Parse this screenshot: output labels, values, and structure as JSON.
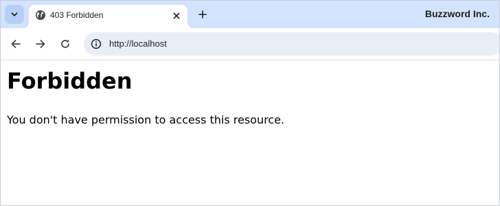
{
  "browser": {
    "tab_search_icon": "chevron-down-icon",
    "tabs": [
      {
        "title": "403 Forbidden",
        "favicon": "globe-icon",
        "close_icon": "close-icon"
      }
    ],
    "new_tab_icon": "plus-icon",
    "profile_name": "Buzzword Inc.",
    "toolbar": {
      "back_icon": "arrow-left-icon",
      "forward_icon": "arrow-right-icon",
      "reload_icon": "reload-icon",
      "site_info_icon": "info-icon",
      "url": "http://localhost"
    },
    "colors": {
      "tabstrip_bg": "#d3e3fd",
      "omnibox_bg": "#e9eef6",
      "icon": "#474747"
    }
  },
  "page": {
    "heading": "Forbidden",
    "message": "You don't have permission to access this resource."
  }
}
